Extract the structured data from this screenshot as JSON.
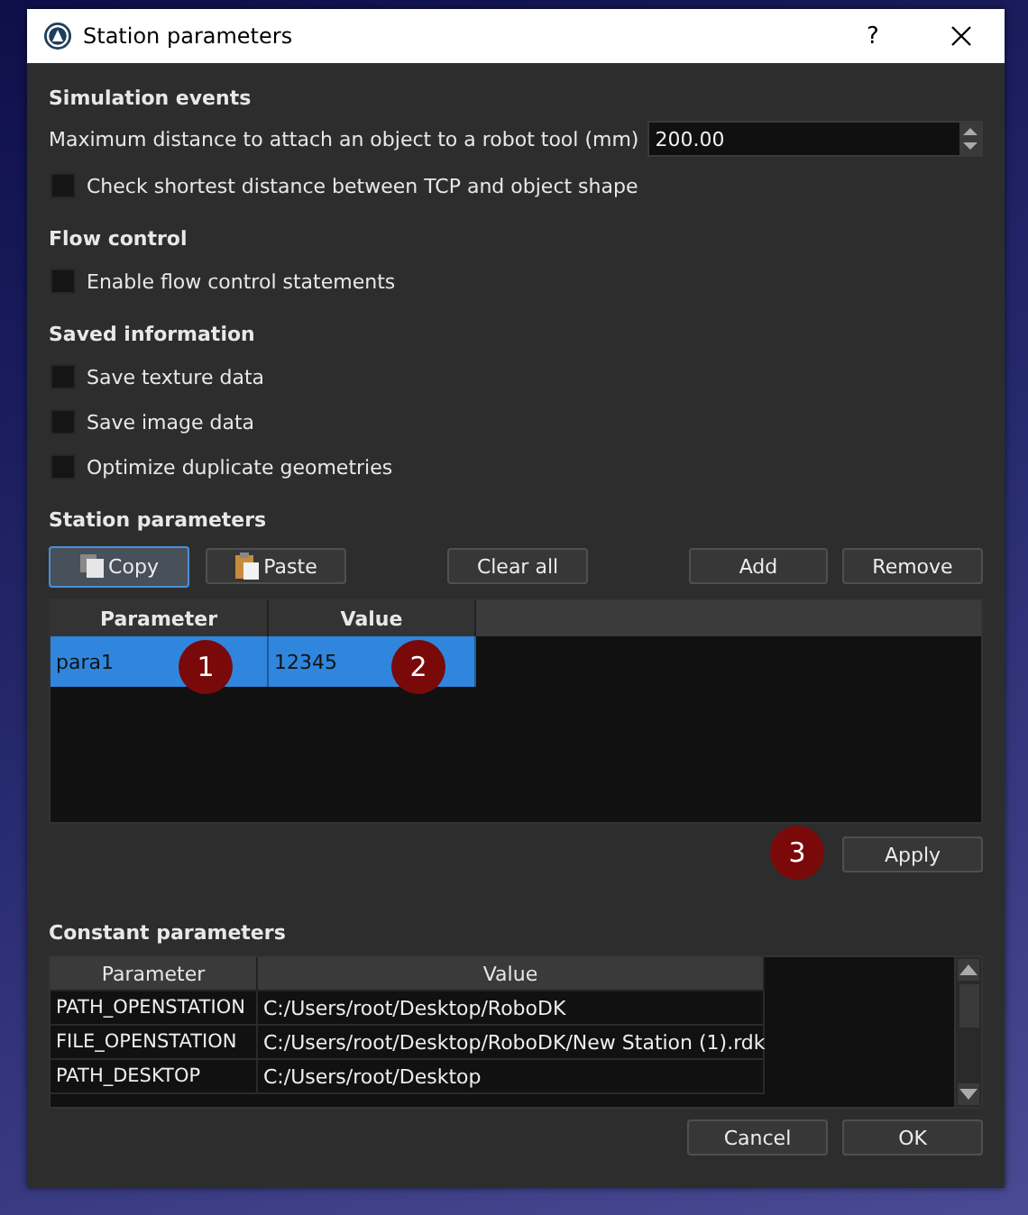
{
  "window": {
    "title": "Station parameters",
    "help": "?"
  },
  "sections": [
    {
      "heading": "Simulation events",
      "items": [
        {
          "kind": "number",
          "label": "Maximum distance to attach an object to a robot tool (mm)",
          "value": "200.00"
        },
        {
          "kind": "checkbox",
          "label": "Check shortest distance between TCP and object shape",
          "checked": false
        }
      ]
    },
    {
      "heading": "Flow control",
      "items": [
        {
          "kind": "checkbox",
          "label": "Enable flow control statements",
          "checked": false
        }
      ]
    },
    {
      "heading": "Saved information",
      "items": [
        {
          "kind": "checkbox",
          "label": "Save texture data",
          "checked": false
        },
        {
          "kind": "checkbox",
          "label": "Save image data",
          "checked": false
        },
        {
          "kind": "checkbox",
          "label": "Optimize duplicate geometries",
          "checked": false
        }
      ]
    }
  ],
  "station_parameters": {
    "heading": "Station parameters",
    "buttons": [
      {
        "kind": "copy",
        "label": "Copy",
        "focused": true
      },
      {
        "kind": "paste",
        "label": "Paste",
        "focused": false
      },
      {
        "kind": "plain",
        "label": "Clear all",
        "focused": false
      },
      {
        "kind": "plain",
        "label": "Add",
        "focused": false
      },
      {
        "kind": "plain",
        "label": "Remove",
        "focused": false
      }
    ],
    "table": {
      "columns": [
        "Parameter",
        "Value"
      ],
      "rows": [
        {
          "cells": [
            "para1",
            "12345"
          ],
          "selected": true
        }
      ]
    },
    "callouts": [
      "1",
      "2",
      "3"
    ],
    "apply": "Apply"
  },
  "constant_parameters": {
    "heading": "Constant parameters",
    "table": {
      "columns": [
        "Parameter",
        "Value"
      ],
      "rows": [
        {
          "cells": [
            "PATH_OPENSTATION",
            "C:/Users/root/Desktop/RoboDK"
          ]
        },
        {
          "cells": [
            "FILE_OPENSTATION",
            "C:/Users/root/Desktop/RoboDK/New Station (1).rdk"
          ]
        },
        {
          "cells": [
            "PATH_DESKTOP",
            "C:/Users/root/Desktop"
          ]
        }
      ]
    }
  },
  "footer": {
    "buttons": [
      "Cancel",
      "OK"
    ]
  }
}
